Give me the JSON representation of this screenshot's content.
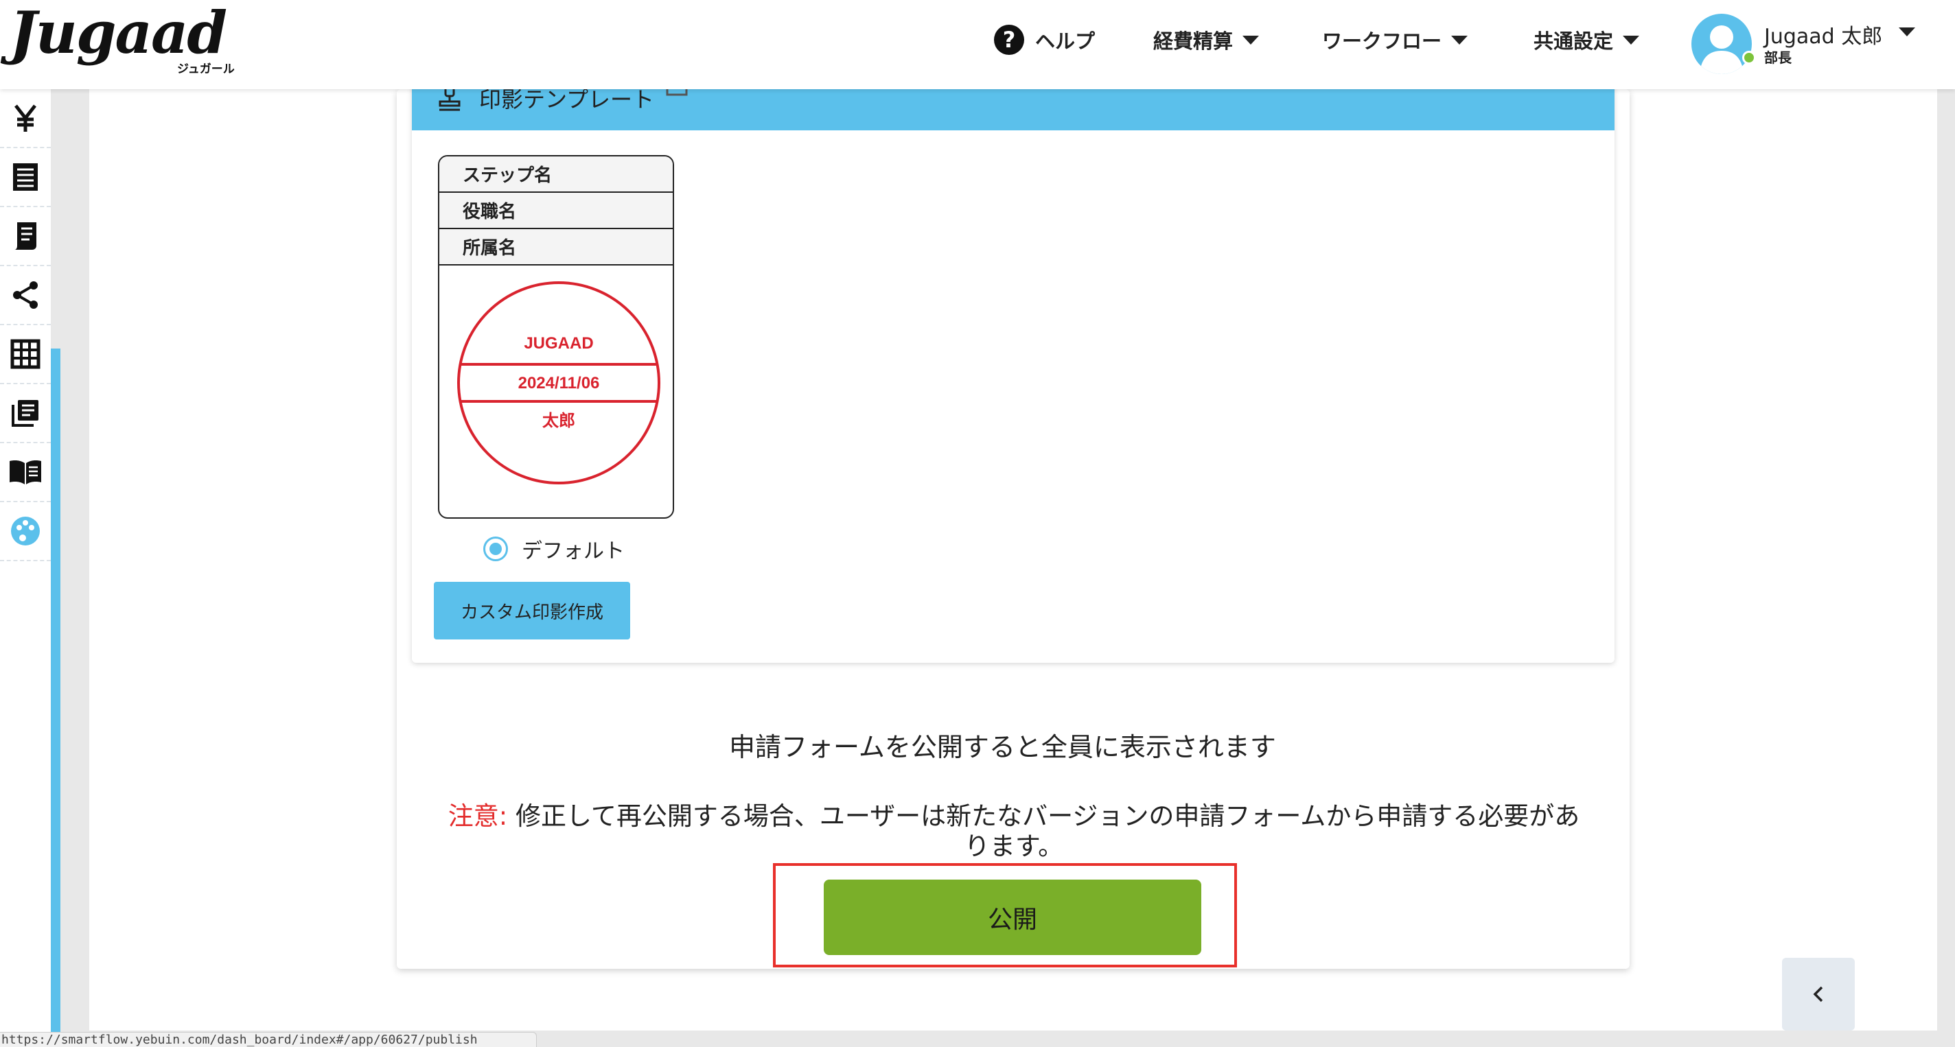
{
  "app": {
    "logo_text": "Jugaad",
    "logo_subtext": "ジュガール"
  },
  "nav": {
    "help": "ヘルプ",
    "expense": "経費精算",
    "workflow": "ワークフロー",
    "common_settings": "共通設定"
  },
  "user": {
    "name": "Jugaad 太郎",
    "role": "部長",
    "status_color": "#7cc33b"
  },
  "sidebar": {
    "items": [
      {
        "icon": "yen-icon"
      },
      {
        "icon": "list-icon"
      },
      {
        "icon": "receipt-icon"
      },
      {
        "icon": "share-icon"
      },
      {
        "icon": "grid-icon"
      },
      {
        "icon": "library-icon"
      },
      {
        "icon": "book-icon"
      },
      {
        "icon": "palette-icon",
        "active": true
      }
    ]
  },
  "stamp_template": {
    "title": "印影テンプレート",
    "rows": [
      "ステップ名",
      "役職名",
      "所属名"
    ],
    "seal": {
      "line1": "JUGAAD",
      "line2": "2024/11/06",
      "line3": "太郎",
      "color": "#d9232e"
    },
    "radio_label": "デフォルト",
    "custom_button": "カスタム印影作成"
  },
  "publish": {
    "notice": "申請フォームを公開すると全員に表示されます",
    "warning_label": "注意:",
    "warning_text": " 修正して再公開する場合、ユーザーは新たなバージョンの申請フォームから申請する必要があります。",
    "button_label": "公開",
    "button_color": "#7aaf29",
    "highlight_color": "#e8302b"
  },
  "status_bar": {
    "url": "https://smartflow.yebuin.com/dash_board/index#/app/60627/publish"
  },
  "colors": {
    "accent": "#5bc0eb"
  }
}
